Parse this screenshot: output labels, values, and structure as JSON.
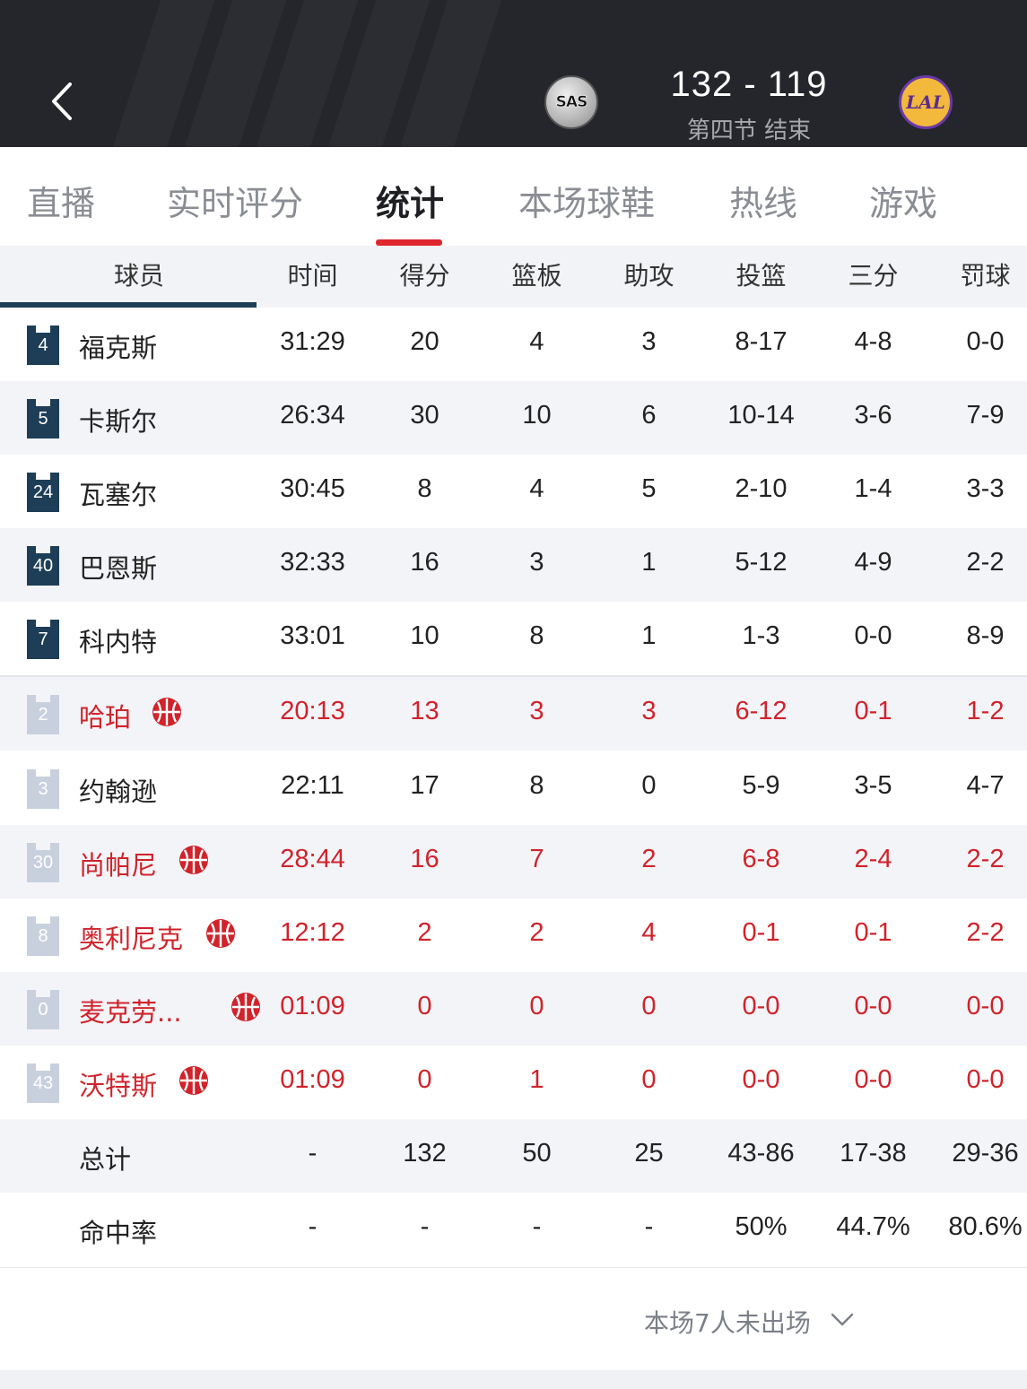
{
  "header": {
    "score": "132 - 119",
    "status": "第四节 结束",
    "home_logo_text": "SAS",
    "away_logo_text": "LAL"
  },
  "tabs": [
    {
      "label": "直播",
      "active": false
    },
    {
      "label": "实时评分",
      "active": false
    },
    {
      "label": "统计",
      "active": true
    },
    {
      "label": "本场球鞋",
      "active": false
    },
    {
      "label": "热线",
      "active": false
    },
    {
      "label": "游戏",
      "active": false
    }
  ],
  "table": {
    "columns": [
      "球员",
      "时间",
      "得分",
      "篮板",
      "助攻",
      "投篮",
      "三分",
      "罚球"
    ],
    "rows": [
      {
        "number": "4",
        "name": "福克斯",
        "time": "31:29",
        "pts": "20",
        "reb": "4",
        "ast": "3",
        "fg": "8-17",
        "tp": "4-8",
        "ft": "0-0",
        "starter": true,
        "highlight": false
      },
      {
        "number": "5",
        "name": "卡斯尔",
        "time": "26:34",
        "pts": "30",
        "reb": "10",
        "ast": "6",
        "fg": "10-14",
        "tp": "3-6",
        "ft": "7-9",
        "starter": true,
        "highlight": false
      },
      {
        "number": "24",
        "name": "瓦塞尔",
        "time": "30:45",
        "pts": "8",
        "reb": "4",
        "ast": "5",
        "fg": "2-10",
        "tp": "1-4",
        "ft": "3-3",
        "starter": true,
        "highlight": false
      },
      {
        "number": "40",
        "name": "巴恩斯",
        "time": "32:33",
        "pts": "16",
        "reb": "3",
        "ast": "1",
        "fg": "5-12",
        "tp": "4-9",
        "ft": "2-2",
        "starter": true,
        "highlight": false
      },
      {
        "number": "7",
        "name": "科内特",
        "time": "33:01",
        "pts": "10",
        "reb": "8",
        "ast": "1",
        "fg": "1-3",
        "tp": "0-0",
        "ft": "8-9",
        "starter": true,
        "highlight": false
      },
      {
        "number": "2",
        "name": "哈珀",
        "time": "20:13",
        "pts": "13",
        "reb": "3",
        "ast": "3",
        "fg": "6-12",
        "tp": "0-1",
        "ft": "1-2",
        "starter": false,
        "highlight": true
      },
      {
        "number": "3",
        "name": "约翰逊",
        "time": "22:11",
        "pts": "17",
        "reb": "8",
        "ast": "0",
        "fg": "5-9",
        "tp": "3-5",
        "ft": "4-7",
        "starter": false,
        "highlight": false
      },
      {
        "number": "30",
        "name": "尚帕尼",
        "time": "28:44",
        "pts": "16",
        "reb": "7",
        "ast": "2",
        "fg": "6-8",
        "tp": "2-4",
        "ft": "2-2",
        "starter": false,
        "highlight": true
      },
      {
        "number": "8",
        "name": "奥利尼克",
        "time": "12:12",
        "pts": "2",
        "reb": "2",
        "ast": "4",
        "fg": "0-1",
        "tp": "0-1",
        "ft": "2-2",
        "starter": false,
        "highlight": true
      },
      {
        "number": "0",
        "name": "麦克劳...",
        "time": "01:09",
        "pts": "0",
        "reb": "0",
        "ast": "0",
        "fg": "0-0",
        "tp": "0-0",
        "ft": "0-0",
        "starter": false,
        "highlight": true
      },
      {
        "number": "43",
        "name": "沃特斯",
        "time": "01:09",
        "pts": "0",
        "reb": "1",
        "ast": "0",
        "fg": "0-0",
        "tp": "0-0",
        "ft": "0-0",
        "starter": false,
        "highlight": true
      }
    ],
    "totals": {
      "label": "总计",
      "time": "-",
      "pts": "132",
      "reb": "50",
      "ast": "25",
      "fg": "43-86",
      "tp": "17-38",
      "ft": "29-36"
    },
    "percentages": {
      "label": "命中率",
      "time": "-",
      "pts": "-",
      "reb": "-",
      "ast": "-",
      "fg": "50%",
      "tp": "44.7%",
      "ft": "80.6%"
    }
  },
  "footer": {
    "dnp_text": "本场7人未出场"
  },
  "colors": {
    "header_bg": "#24262b",
    "accent_red": "#d0232b",
    "jersey_starter": "#1d3e56",
    "jersey_bench": "#c8d0de",
    "row_alt": "#f3f4f8"
  },
  "icons": {
    "back": "chevron-left-icon",
    "highlight": "basketball-icon",
    "expand": "chevron-down-icon"
  }
}
